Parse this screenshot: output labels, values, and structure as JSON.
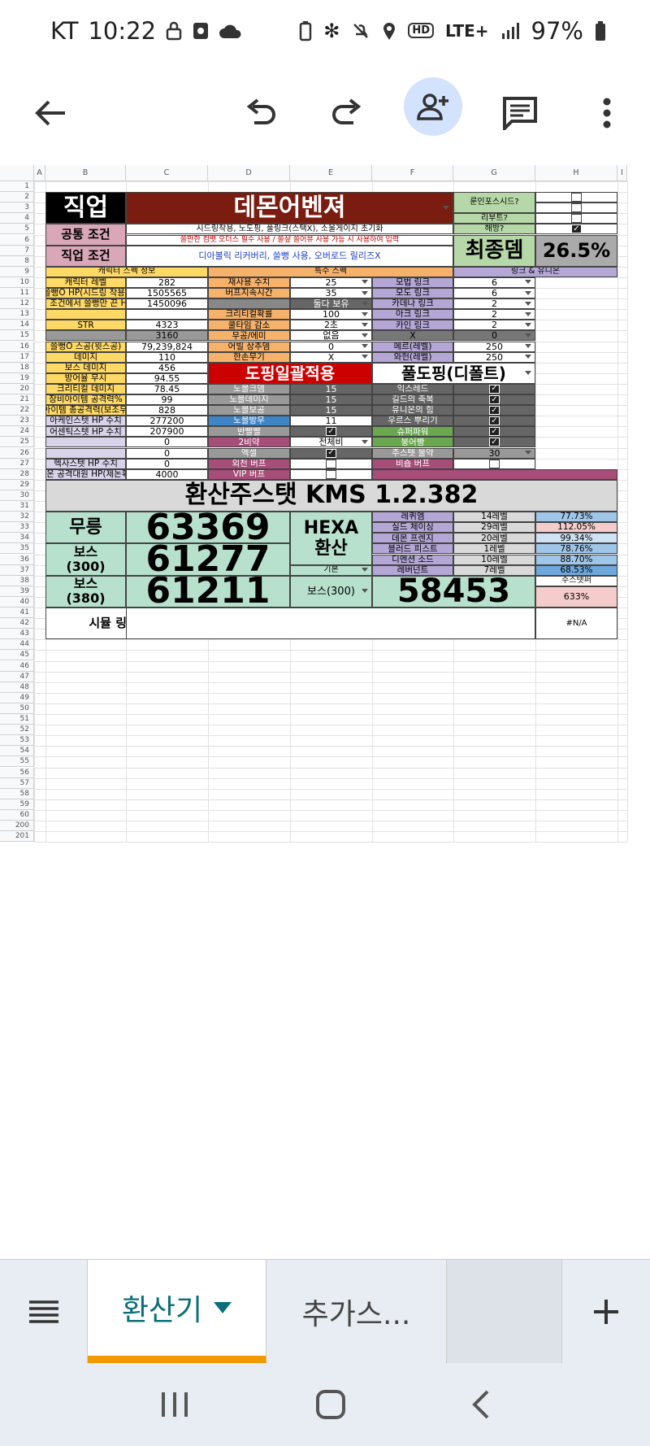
{
  "status": {
    "carrier": "KT",
    "time": "10:22",
    "network": "LTE+",
    "battery": "97%"
  },
  "columns": [
    "A",
    "B",
    "C",
    "D",
    "E",
    "F",
    "G",
    "H",
    "I"
  ],
  "sheet": {
    "job_label": "직업",
    "job_value": "데몬어벤져",
    "common_label": "공통 조건",
    "common_line1": "시드링착용, 노도핑, 풀링크(스택X), 소울게이지 초기화",
    "common_line2": "쓸만한 컴뱃 오더스 필수 사용 / 쓸샾 쓸어뷰 사용 가능 시 사용하여 입력",
    "jobcond_label": "직업 조건",
    "jobcond_value": "디아볼릭 리커버리, 쓸뻥 사용, 오버로드 릴리즈X",
    "q_roon": "룬인포스시드?",
    "q_libot": "리부트?",
    "q_haebang": "해방?",
    "final_label": "최종뎀",
    "final_value": "26.5%",
    "hdr_char": "캐릭터 스펙 정보",
    "hdr_special": "특수 스펙",
    "hdr_link": "링크 & 유니온",
    "char_rows": [
      {
        "label": "캐릭터 레벨",
        "value": "282"
      },
      {
        "label": "쓸뻥O HP(시드링 착용)",
        "value": "1505565"
      },
      {
        "label": "위 조건에서 쓸뻥만 끈 HP",
        "value": "1450096"
      },
      {
        "label": "",
        "value": ""
      },
      {
        "label": "STR",
        "value": "4323"
      },
      {
        "label": "",
        "value": "3160"
      },
      {
        "label": "쓸뻥O 스공(윗스공)",
        "value": "79,239,824"
      },
      {
        "label": "데미지",
        "value": "110"
      },
      {
        "label": "보스 데미지",
        "value": "456"
      },
      {
        "label": "방어율 무시",
        "value": "94.55"
      },
      {
        "label": "크리티컬 데미지",
        "value": "78.45"
      },
      {
        "label": "장비아이템 공격력%",
        "value": "99"
      },
      {
        "label": "무기아이템 총공격력(보조무기X)",
        "value": "828"
      },
      {
        "label": "아케인스텟 HP 수치",
        "value": "277200"
      },
      {
        "label": "어센틱스텟 HP 수치",
        "value": "207900"
      },
      {
        "label": "",
        "value": "0"
      },
      {
        "label": "",
        "value": "0"
      },
      {
        "label": "헥사스텟 HP 수치",
        "value": "0"
      },
      {
        "label": "유니온 공격대원 HP(제논확인)",
        "value": "4000"
      }
    ],
    "special_rows": [
      {
        "label": "재사용 수치",
        "value": "25"
      },
      {
        "label": "버프지속시간",
        "value": "35"
      },
      {
        "label": "",
        "value": "둘다 보유"
      },
      {
        "label": "크리티컬확률",
        "value": "100"
      },
      {
        "label": "쿨타임 감소",
        "value": "2초"
      },
      {
        "label": "무공/에미",
        "value": "없음"
      },
      {
        "label": "어빌 상추뎀",
        "value": "0"
      },
      {
        "label": "한손무기",
        "value": "X"
      }
    ],
    "link_rows": [
      {
        "label": "모법 링크",
        "value": "6"
      },
      {
        "label": "모도 링크",
        "value": "6"
      },
      {
        "label": "카데나 링크",
        "value": "2"
      },
      {
        "label": "아크 링크",
        "value": "2"
      },
      {
        "label": "카인 링크",
        "value": "2"
      },
      {
        "label": "X",
        "value": "0"
      },
      {
        "label": "메르(레벨)",
        "value": "250"
      },
      {
        "label": "와헌(레벨)",
        "value": "250"
      }
    ],
    "doping_label": "도핑일괄적용",
    "fulldoping_label": "풀도핑(디폴트)",
    "noblesse_rows": [
      {
        "label": "노블크뎀",
        "value": "15"
      },
      {
        "label": "노블데미지",
        "value": "15"
      },
      {
        "label": "노블보공",
        "value": "15"
      },
      {
        "label": "노블방무",
        "value": "11"
      },
      {
        "label": "반빨빨",
        "value": ""
      },
      {
        "label": "2비약",
        "value": "전체비"
      },
      {
        "label": "엑셀",
        "value": ""
      },
      {
        "label": "외천 버프",
        "value": ""
      },
      {
        "label": "VIP 버프",
        "value": ""
      }
    ],
    "buff_rows": [
      {
        "label": "익스레드"
      },
      {
        "label": "길드의 축복"
      },
      {
        "label": "유니온의 힘"
      },
      {
        "label": "우르스 뿌리기"
      },
      {
        "label": "슈퍼파워"
      },
      {
        "label": "붕어빵"
      },
      {
        "label": "주스텟 물약",
        "value": "30"
      },
      {
        "label": "비숍 버프"
      }
    ],
    "banner": "환산주스탯 KMS 1.2.382",
    "mureung_label": "무릉",
    "mureung_value": "63369",
    "boss300_label": "보스\n(300)",
    "boss300_value": "61277",
    "boss380_label": "보스\n(380)",
    "boss380_value": "61211",
    "hexa_label": "HEXA\n환산",
    "hexa_mode": "기본",
    "hexa_boss_label": "보스(300)",
    "hexa_value": "58453",
    "hexa_rows": [
      {
        "skill": "레퀴엠",
        "level": "14레벨",
        "pct": "77.73%"
      },
      {
        "skill": "실드 체이싱",
        "level": "29레벨",
        "pct": "112.05%"
      },
      {
        "skill": "데몬 프렌지",
        "level": "20레벨",
        "pct": "99.34%"
      },
      {
        "skill": "블러드 피스트",
        "level": "1레벨",
        "pct": "78.76%"
      },
      {
        "skill": "디멘션 소드",
        "level": "10레벨",
        "pct": "88.70%"
      },
      {
        "skill": "레버넌트",
        "level": "7레벨",
        "pct": "68.53%"
      }
    ],
    "juseutaeng_label": "주스텟퍼",
    "juseutaeng_value": "633%",
    "link_input_label": "시뮬 링크 입력",
    "na_value": "#N/A"
  },
  "tabs": {
    "active": "환산기",
    "other": "추가스..."
  },
  "colors": {
    "accent": "#f29900",
    "header_red": "#7b1c10",
    "orange": "#f6b26b",
    "yellow": "#ffd966",
    "pink": "#d9a7b7",
    "lavender": "#b4a7d6",
    "green": "#b6d7a8",
    "mint": "#b7e1cd",
    "blue": "#9fc5e8"
  }
}
